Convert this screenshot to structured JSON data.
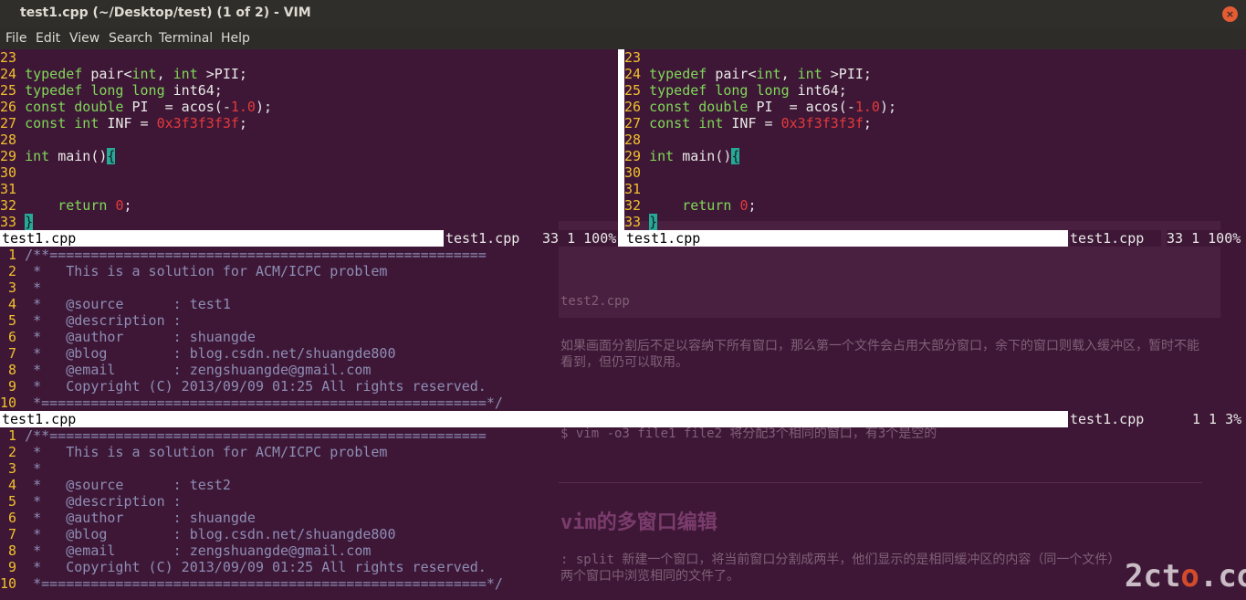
{
  "window": {
    "title": "test1.cpp (~/Desktop/test) (1 of 2) - VIM",
    "close_glyph": "×"
  },
  "menu": [
    "File",
    "Edit",
    "View",
    "Search",
    "Terminal",
    "Help"
  ],
  "colors": {
    "line_number": "#f0c02c",
    "keyword": "#7fd957",
    "constant": "#e43a3a",
    "comment": "#8e8eb4",
    "cursor": "#27a99a",
    "background": "#3e1737"
  },
  "top_code": [
    {
      "n": "23",
      "parts": []
    },
    {
      "n": "24",
      "parts": [
        {
          "t": "typedef",
          "c": "kw"
        },
        {
          "t": " pair<",
          "c": ""
        },
        {
          "t": "int",
          "c": "kw"
        },
        {
          "t": ", ",
          "c": ""
        },
        {
          "t": "int",
          "c": "kw"
        },
        {
          "t": " >PII;",
          "c": ""
        }
      ]
    },
    {
      "n": "25",
      "parts": [
        {
          "t": "typedef",
          "c": "kw"
        },
        {
          "t": " ",
          "c": ""
        },
        {
          "t": "long long",
          "c": "kw"
        },
        {
          "t": " int64;",
          "c": ""
        }
      ]
    },
    {
      "n": "26",
      "parts": [
        {
          "t": "const double",
          "c": "kw"
        },
        {
          "t": " PI  = acos(-",
          "c": ""
        },
        {
          "t": "1.0",
          "c": "str"
        },
        {
          "t": ");",
          "c": ""
        }
      ]
    },
    {
      "n": "27",
      "parts": [
        {
          "t": "const int",
          "c": "kw"
        },
        {
          "t": " INF = ",
          "c": ""
        },
        {
          "t": "0x3f3f3f3f",
          "c": "str"
        },
        {
          "t": ";",
          "c": ""
        }
      ]
    },
    {
      "n": "28",
      "parts": []
    },
    {
      "n": "29",
      "parts": [
        {
          "t": "int",
          "c": "kw"
        },
        {
          "t": " main()",
          "c": ""
        },
        {
          "t": "{",
          "c": "cur"
        }
      ]
    },
    {
      "n": "30",
      "parts": []
    },
    {
      "n": "31",
      "parts": []
    },
    {
      "n": "32",
      "parts": [
        {
          "t": "    ",
          "c": ""
        },
        {
          "t": "return",
          "c": "kw"
        },
        {
          "t": " ",
          "c": ""
        },
        {
          "t": "0",
          "c": "str"
        },
        {
          "t": ";",
          "c": ""
        }
      ]
    },
    {
      "n": "33",
      "parts": [
        {
          "t": "}",
          "c": "cur"
        }
      ]
    }
  ],
  "file1_header": [
    {
      "n": "1",
      "parts": [
        {
          "t": "/**",
          "c": "cm"
        },
        {
          "t": "=====================================================",
          "c": "cm"
        }
      ]
    },
    {
      "n": "2",
      "parts": [
        {
          "t": " *   This is a solution for ACM/ICPC problem",
          "c": "cm"
        }
      ]
    },
    {
      "n": "3",
      "parts": [
        {
          "t": " *",
          "c": "cm"
        }
      ]
    },
    {
      "n": "4",
      "parts": [
        {
          "t": " *   @source      : ",
          "c": "cm"
        },
        {
          "t": "test1",
          "c": "cm"
        }
      ]
    },
    {
      "n": "5",
      "parts": [
        {
          "t": " *   @description :",
          "c": "cm"
        }
      ]
    },
    {
      "n": "6",
      "parts": [
        {
          "t": " *   @author      : shuangde",
          "c": "cm"
        }
      ]
    },
    {
      "n": "7",
      "parts": [
        {
          "t": " *   @blog        : blog.csdn.net/shuangde800",
          "c": "cm"
        }
      ]
    },
    {
      "n": "8",
      "parts": [
        {
          "t": " *   @email       : zengshuangde@gmail.com",
          "c": "cm"
        }
      ]
    },
    {
      "n": "9",
      "parts": [
        {
          "t": " *   Copyright (C) 2013/09/09 01:25 All rights reserved.",
          "c": "cm"
        }
      ]
    },
    {
      "n": "10",
      "parts": [
        {
          "t": " *======================================================*/",
          "c": "cm"
        }
      ]
    }
  ],
  "file2_header": [
    {
      "n": "1",
      "parts": [
        {
          "t": "/**",
          "c": "cm"
        },
        {
          "t": "=====================================================",
          "c": "cm"
        }
      ]
    },
    {
      "n": "2",
      "parts": [
        {
          "t": " *   This is a solution for ACM/ICPC problem",
          "c": "cm"
        }
      ]
    },
    {
      "n": "3",
      "parts": [
        {
          "t": " *",
          "c": "cm"
        }
      ]
    },
    {
      "n": "4",
      "parts": [
        {
          "t": " *   @source      : test2",
          "c": "cm"
        }
      ]
    },
    {
      "n": "5",
      "parts": [
        {
          "t": " *   @description :",
          "c": "cm"
        }
      ]
    },
    {
      "n": "6",
      "parts": [
        {
          "t": " *   @author      : shuangde",
          "c": "cm"
        }
      ]
    },
    {
      "n": "7",
      "parts": [
        {
          "t": " *   @blog        : blog.csdn.net/shuangde800",
          "c": "cm"
        }
      ]
    },
    {
      "n": "8",
      "parts": [
        {
          "t": " *   @email       : zengshuangde@gmail.com",
          "c": "cm"
        }
      ]
    },
    {
      "n": "9",
      "parts": [
        {
          "t": " *   Copyright (C) 2013/09/09 01:25 All rights reserved.",
          "c": "cm"
        }
      ]
    },
    {
      "n": "10",
      "parts": [
        {
          "t": " *======================================================*/",
          "c": "cm"
        }
      ]
    }
  ],
  "status": {
    "top_left_name": "test1.cpp",
    "top_left_right_name": "test1.cpp",
    "top_left_pos": "33 1 100%",
    "top_right_name": "test1.cpp",
    "top_right_right_name": "test1.cpp",
    "top_right_pos": "33 1 100%",
    "mid_name": "test1.cpp",
    "mid_right_name": "test1.cpp",
    "mid_pos": "1 1 3%"
  },
  "background_page": {
    "line1": "如果画面分割后不足以容纳下所有窗口，那么第一个文件会占用大部分窗口，余下的窗口则载入缓冲区，暂时不能",
    "line2": "看到，但仍可以取用。",
    "line3": "$ vim -o3 file1 file2 将分配3个相同的窗口，有3个是空的",
    "heading": "vim的多窗口编辑",
    "para1": ": split   新建一个窗口，将当前窗口分割成两半，他们显示的是相同缓冲区的内容（同一个文件）",
    "para2": "两个窗口中浏览相同的文件了。",
    "ghost_status": "test2.cpp",
    "watermark_a": "2ct",
    "watermark_o": "o",
    "watermark_b": ".com"
  }
}
